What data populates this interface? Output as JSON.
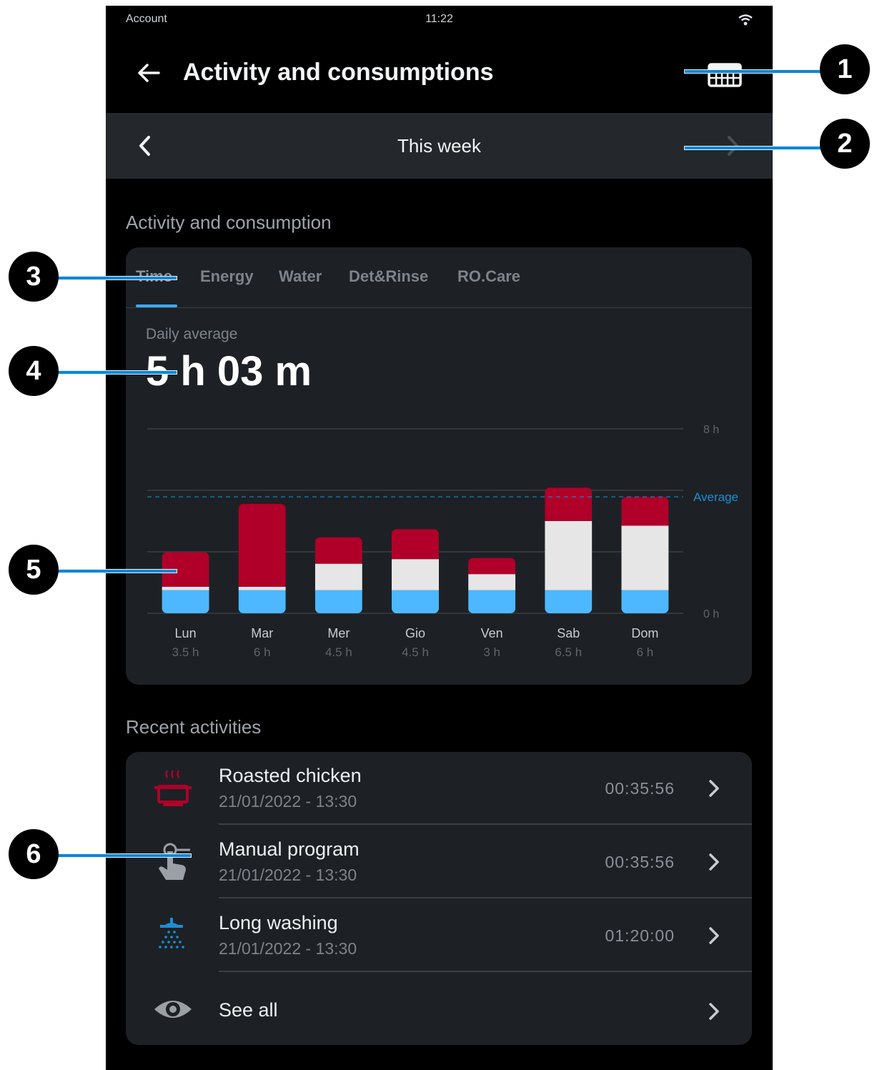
{
  "status_bar": {
    "carrier": "Account",
    "time": "11:22"
  },
  "app_bar": {
    "title": "Activity and consumptions"
  },
  "period": {
    "label": "This week"
  },
  "activity_section": {
    "title": "Activity and consumption",
    "tabs": [
      "Time",
      "Energy",
      "Water",
      "Det&Rinse",
      "RO.Care"
    ],
    "active_tab": "Time",
    "daily_average_label": "Daily average",
    "daily_average_value": "5 h 03 m"
  },
  "chart_data": {
    "type": "bar",
    "stacked": true,
    "categories": [
      "Lun",
      "Mar",
      "Mer",
      "Gio",
      "Ven",
      "Sab",
      "Dom"
    ],
    "category_totals": [
      "3.5 h",
      "6 h",
      "4.5 h",
      "4.5 h",
      "3 h",
      "6.5 h",
      "6 h"
    ],
    "series": [
      {
        "color": "#4db8ff",
        "values": [
          1.0,
          1.0,
          1.0,
          1.0,
          1.0,
          1.0,
          1.0
        ]
      },
      {
        "color": "#e6e6e6",
        "values": [
          0.15,
          0.15,
          1.15,
          1.35,
          0.7,
          3.0,
          2.8
        ]
      },
      {
        "color": "#b0002a",
        "values": [
          1.5,
          3.6,
          1.15,
          1.3,
          0.7,
          1.45,
          1.25
        ]
      }
    ],
    "ylim": [
      0,
      8
    ],
    "y_tick_labels": [
      "0 h",
      "8 h"
    ],
    "average": {
      "value": 5.05,
      "label": "Average",
      "color": "#1a8fd6"
    },
    "grid": true
  },
  "recent_section": {
    "title": "Recent activities",
    "items": [
      {
        "name": "Roasted chicken",
        "date": "21/01/2022 - 13:30",
        "duration": "00:35:56",
        "icon": "roasting-pot-icon"
      },
      {
        "name": "Manual program",
        "date": "21/01/2022 - 13:30",
        "duration": "00:35:56",
        "icon": "manual-touch-icon"
      },
      {
        "name": "Long washing",
        "date": "21/01/2022 - 13:30",
        "duration": "01:20:00",
        "icon": "shower-washing-icon"
      }
    ],
    "see_all": "See all"
  },
  "callouts": [
    "1",
    "2",
    "3",
    "4",
    "5",
    "6"
  ],
  "colors": {
    "accent": "#3fa9f5",
    "leader": "#0a88d8",
    "red": "#b0002a"
  }
}
